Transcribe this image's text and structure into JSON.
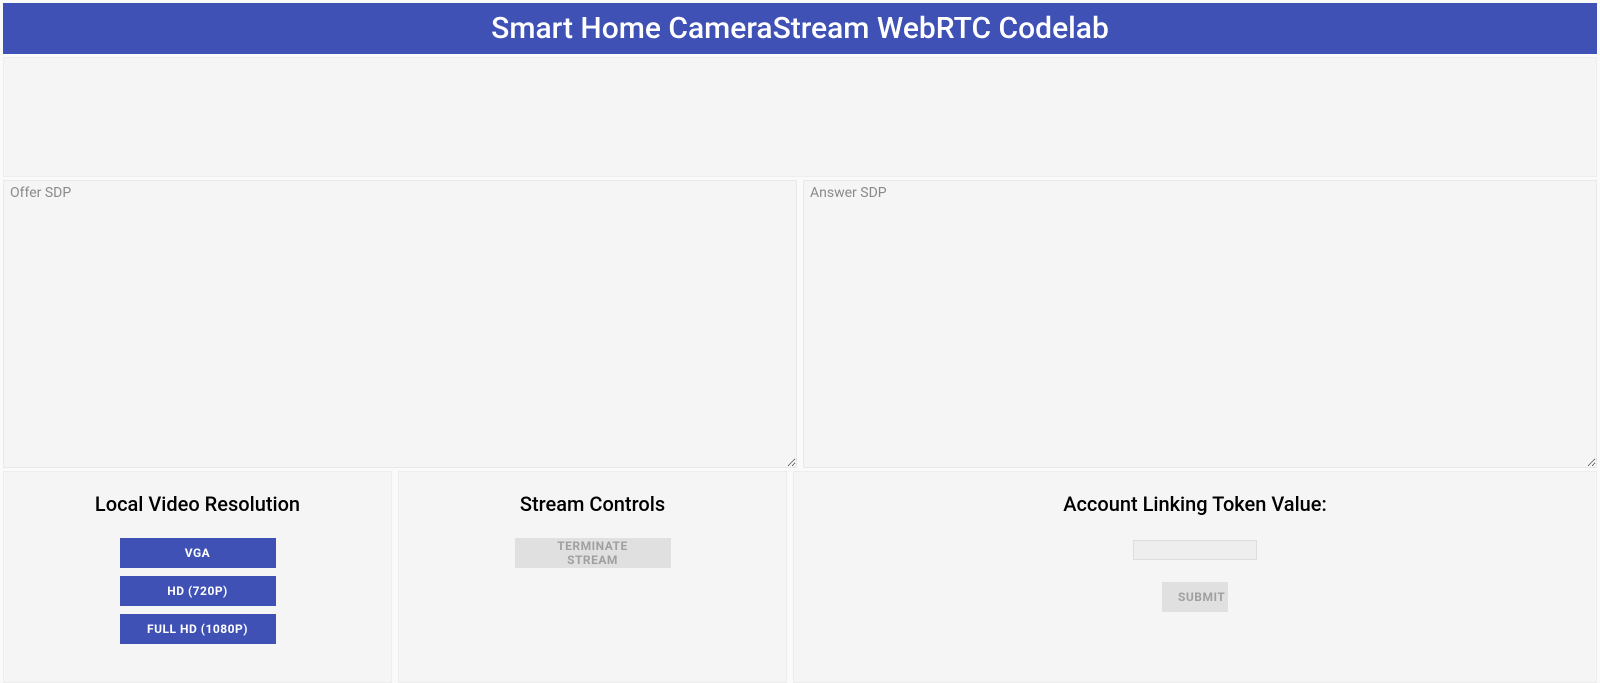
{
  "header": {
    "title": "Smart Home CameraStream WebRTC Codelab"
  },
  "sdp": {
    "offer_placeholder": "Offer SDP",
    "offer_value": "",
    "answer_placeholder": "Answer SDP",
    "answer_value": ""
  },
  "panels": {
    "resolution": {
      "title": "Local Video Resolution",
      "buttons": {
        "vga": "VGA",
        "hd": "HD (720P)",
        "fullhd": "FULL HD (1080P)"
      }
    },
    "stream": {
      "title": "Stream Controls",
      "terminate": "TERMINATE STREAM"
    },
    "token": {
      "title": "Account Linking Token Value:",
      "value": "",
      "submit": "SUBMIT"
    }
  }
}
